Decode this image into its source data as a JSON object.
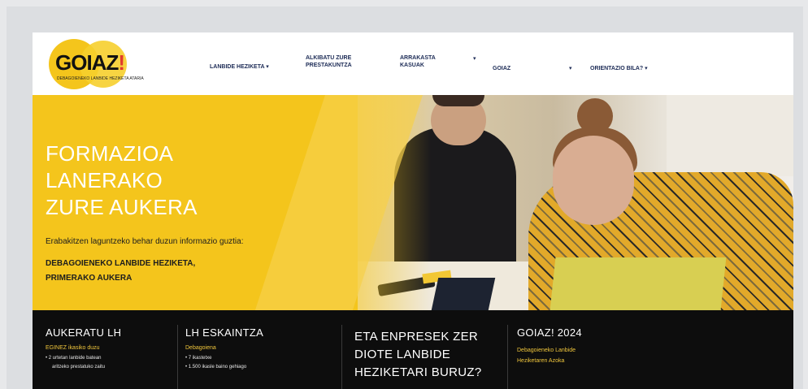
{
  "logo": {
    "word": "GOIAZ",
    "excl": "!",
    "tagline": "DEBAGOIENEKO LANBIDE HEZIKETA ATARIA"
  },
  "nav": {
    "items": [
      {
        "label": "LANBIDE HEZIKETA",
        "caret": "▾"
      },
      {
        "label_lines": [
          "ALKIBATU ZURE",
          "PRESTAKUNTZA"
        ]
      },
      {
        "label_lines": [
          "ARRAKASTA",
          "KASUAK"
        ],
        "caret": "▾"
      },
      {
        "label": "GOIAZ",
        "caret": "▾"
      },
      {
        "label": "ORIENTAZIO BILA?",
        "caret": "▾"
      }
    ]
  },
  "hero": {
    "title_lines": [
      "FORMAZIOA",
      "LANERAKO",
      "ZURE AUKERA"
    ],
    "subtitle": "Erabakitzen laguntzeko behar duzun informazio guztia:",
    "bold_lines": [
      "DEBAGOIENEKO LANBIDE HEZIKETA,",
      "PRIMERAKO AUKERA"
    ]
  },
  "columns": [
    {
      "title": "AUKERATU LH",
      "link": "EGINEZ ikasiko duzu",
      "bullets": [
        "• 2 urtetan lanbide batean",
        "  aritzeko prestatuko zaitu"
      ]
    },
    {
      "title": "LH ESKAINTZA",
      "link": "Debagoiena",
      "bullets": [
        "• 7 ikastetxe",
        "• 1.500 ikasle baino gehiago"
      ]
    },
    {
      "title_lines": [
        "ETA ENPRESEK ZER",
        "DIOTE LANBIDE",
        "HEZIKETARI BURUZ?"
      ]
    },
    {
      "title": "GOIAZ! 2024",
      "link_lines": [
        "Debagoieneko Lanbide",
        "Heziketaren Azoka"
      ]
    }
  ],
  "colors": {
    "accent": "#f4c51c",
    "dark": "#0d0d0d",
    "nav_text": "#1c2b56"
  }
}
